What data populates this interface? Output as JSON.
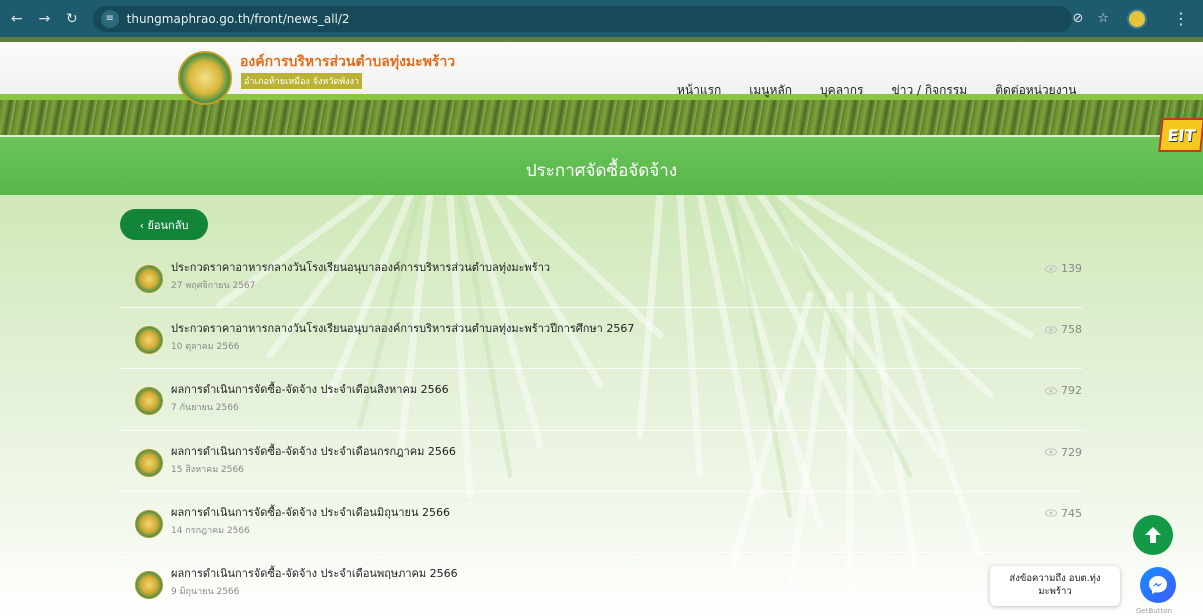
{
  "browser": {
    "url": "thungmaphrao.go.th/front/news_all/2",
    "back_icon": "arrow-left",
    "forward_icon": "arrow-right",
    "reload_icon": "reload"
  },
  "site": {
    "title": "องค์การบริหารส่วนตำบลทุ่งมะพร้าว",
    "subtitle": "อำเภอท้ายเหมือง จังหวัดพังงา"
  },
  "nav": {
    "items": [
      "หน้าแรก",
      "เมนูหลัก",
      "บุคลากร",
      "ข่าว / กิจกรรม",
      "ติดต่อหน่วยงาน"
    ]
  },
  "banner": {
    "title": "ประกาศจัดซื้อจัดจ้าง",
    "badge": "EIT"
  },
  "back_button": {
    "label": "‹ ย้อนกลับ"
  },
  "news": [
    {
      "title": "ประกวดราคาอาหารกลางวันโรงเรียนอนุบาลองค์การบริหารส่วนตำบลทุ่งมะพร้าว",
      "date": "27 พฤศจิกายน 2567",
      "views": "139"
    },
    {
      "title": "ประกวดราคาอาหารกลางวันโรงเรียนอนุบาลองค์การบริหารส่วนตำบลทุ่งมะพร้าวปีการศึกษา 2567",
      "date": "10 ตุลาคม 2566",
      "views": "758"
    },
    {
      "title": "ผลการดำเนินการจัดซื้อ-จัดจ้าง ประจำเดือนสิงหาคม 2566",
      "date": "7 กันยายน 2566",
      "views": "792"
    },
    {
      "title": "ผลการดำเนินการจัดซื้อ-จัดจ้าง ประจำเดือนกรกฎาคม 2566",
      "date": "15 สิงหาคม 2566",
      "views": "729"
    },
    {
      "title": "ผลการดำเนินการจัดซื้อ-จัดจ้าง ประจำเดือนมิถุนายน 2566",
      "date": "14 กรกฎาคม 2566",
      "views": "745"
    },
    {
      "title": "ผลการดำเนินการจัดซื้อ-จัดจ้าง ประจำเดือนพฤษภาคม 2566",
      "date": "9 มิถุนายน 2566",
      "views": ""
    }
  ],
  "chat": {
    "message": "ส่งข้อความถึง อบต.ทุ่งมะพร้าว",
    "footer": "GetButton"
  },
  "colors": {
    "browser_bar": "#1f5b6e",
    "banner": "#5bb84b",
    "back_button": "#13853b",
    "scroll_top": "#139a47"
  }
}
